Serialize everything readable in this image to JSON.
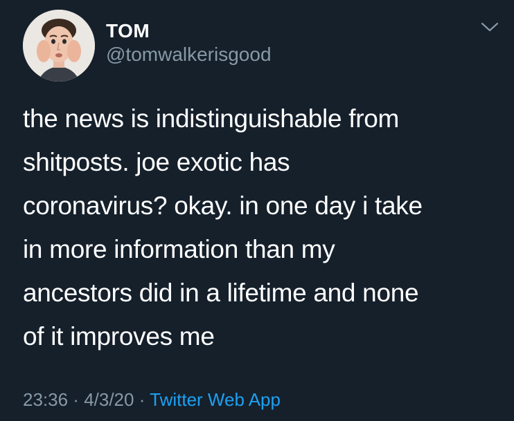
{
  "user": {
    "display_name": "TOM",
    "handle": "@tomwalkerisgood",
    "avatar_icon": "profile-photo"
  },
  "tweet": {
    "text": "the news is indistinguishable from\nshitposts. joe exotic has\ncoronavirus? okay. in one day i take\nin more information than my\nancestors did in a lifetime and none\nof it improves me",
    "time": "23:36",
    "separator": " · ",
    "date": "4/3/20",
    "source": "Twitter Web App"
  },
  "icons": {
    "menu": "chevron-down-icon"
  },
  "colors": {
    "background": "#15202b",
    "primary_text": "#ffffff",
    "secondary_text": "#8899a6",
    "link": "#1da1f2"
  }
}
